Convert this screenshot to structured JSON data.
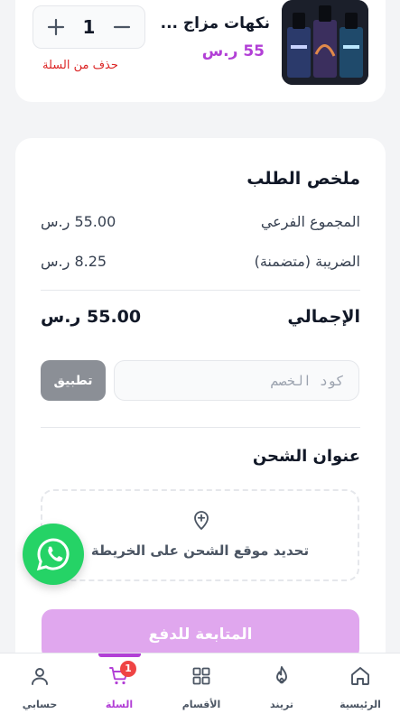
{
  "cart_item": {
    "name": "نكهات مزاج ...",
    "price": "55 ر.س",
    "quantity": "1",
    "remove_label": "حذف من السلة"
  },
  "summary": {
    "title": "ملخص الطلب",
    "subtotal_label": "المجموع الفرعي",
    "subtotal_value": "55.00 ر.س",
    "tax_label": "الضريبة (متضمنة)",
    "tax_value": "8.25 ر.س",
    "total_label": "الإجمالي",
    "total_value": "55.00 ر.س"
  },
  "coupon": {
    "placeholder": "كود الخصم",
    "apply_label": "تطبيق"
  },
  "shipping": {
    "title": "عنوان الشحن",
    "map_label": "تحديد موقع الشحن على الخريطة"
  },
  "checkout_label": "المتابعة للدفع",
  "bottom_nav": {
    "items": [
      {
        "label": "الرئيسية",
        "icon": "home-icon"
      },
      {
        "label": "تريند",
        "icon": "flame-icon"
      },
      {
        "label": "الأقسام",
        "icon": "grid-icon"
      },
      {
        "label": "السلة",
        "icon": "cart-icon",
        "badge": "1"
      },
      {
        "label": "حسابي",
        "icon": "user-icon"
      }
    ]
  },
  "colors": {
    "accent": "#b23fd6",
    "checkout_disabled": "#e0a7ee",
    "danger": "#dc2626",
    "whatsapp": "#25d366"
  }
}
